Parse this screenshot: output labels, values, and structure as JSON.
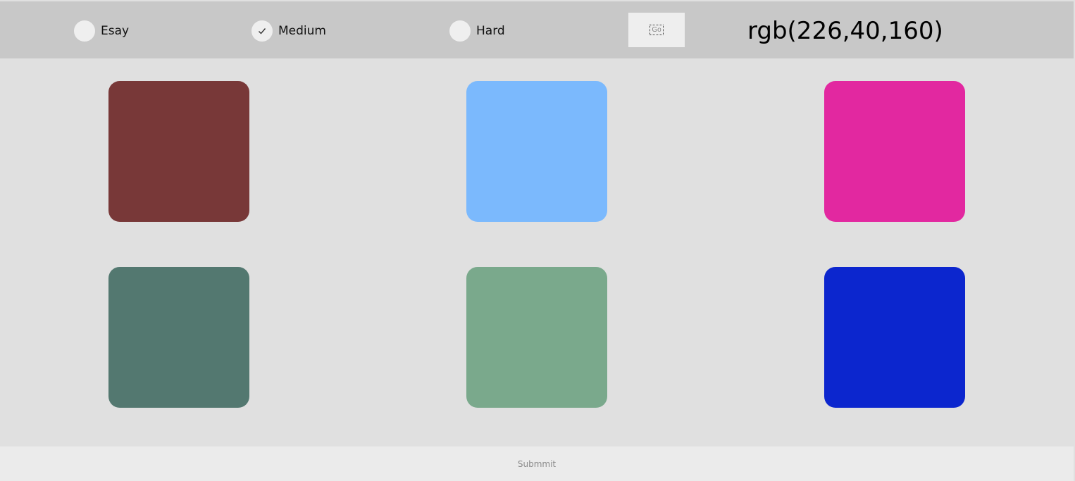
{
  "header": {
    "modes": [
      {
        "label": "Esay",
        "selected": false
      },
      {
        "label": "Medium",
        "selected": true
      },
      {
        "label": "Hard",
        "selected": false
      }
    ],
    "go_label": "Go",
    "target_color": "rgb(226,40,160)"
  },
  "swatches": [
    {
      "color": "#783838"
    },
    {
      "color": "#7bb9fd"
    },
    {
      "color": "#e228a0"
    },
    {
      "color": "#537870"
    },
    {
      "color": "#7aa98c"
    },
    {
      "color": "#0c26ce"
    }
  ],
  "footer": {
    "submit_label": "Submmit"
  },
  "icons": {
    "check": "check-icon"
  }
}
